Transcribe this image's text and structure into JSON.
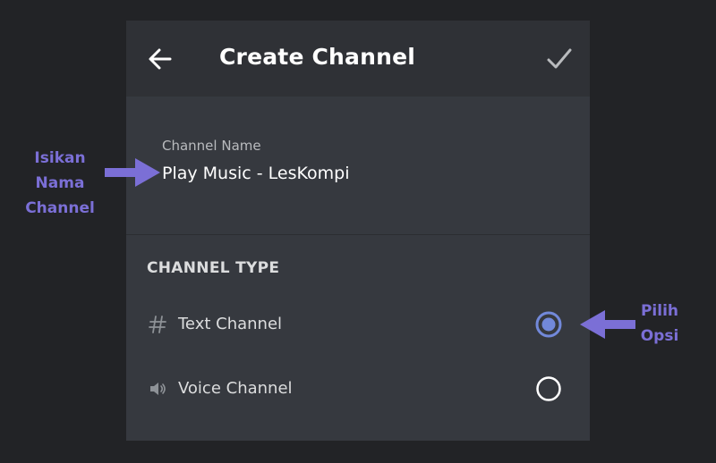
{
  "header": {
    "title": "Create Channel",
    "back_icon": "arrow-left-icon",
    "confirm_icon": "checkmark-icon"
  },
  "channel_name": {
    "label": "Channel Name",
    "value": "Play Music - LesKompi"
  },
  "channel_type": {
    "heading": "CHANNEL TYPE",
    "options": [
      {
        "label": "Text Channel",
        "icon": "hash-icon",
        "selected": true
      },
      {
        "label": "Voice Channel",
        "icon": "speaker-icon",
        "selected": false
      }
    ]
  },
  "annotations": {
    "left_line1": "Isikan",
    "left_line2": "Nama Channel",
    "right_line1": "Pilih",
    "right_line2": "Opsi"
  },
  "colors": {
    "background": "#222326",
    "panel": "#36393f",
    "header": "#2f3136",
    "radio_selected": "#7289da",
    "annotation": "#7b6fd6"
  }
}
